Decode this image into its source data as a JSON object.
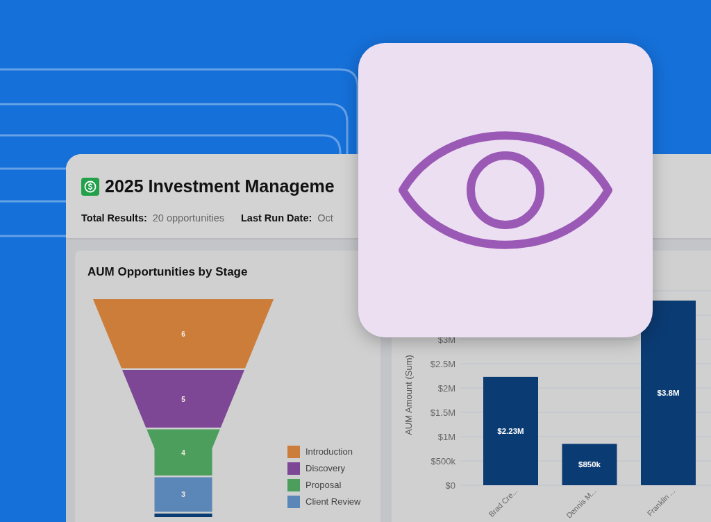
{
  "window": {
    "title": "2025 Investment Manageme",
    "meta": [
      {
        "label": "Total Results:",
        "value": "20 opportunities"
      },
      {
        "label": "Last Run Date:",
        "value": "Oct"
      }
    ]
  },
  "panels": [
    {
      "kind": "funnel",
      "title": "AUM Opportunities by Stage",
      "stages": [
        {
          "label": "Introduction",
          "value": "6",
          "color": "#cc7d3a"
        },
        {
          "label": "Discovery",
          "value": "5",
          "color": "#7d4795"
        },
        {
          "label": "Proposal",
          "value": "4",
          "color": "#4c9e5c"
        },
        {
          "label": "Client Review",
          "value": "3",
          "color": "#5b87b8"
        },
        {
          "color": "#0b3b73"
        }
      ]
    },
    {
      "kind": "bar",
      "chart_data": {
        "type": "bar",
        "ylabel": "AUM Amount (Sum)",
        "categories": [
          "Brad Cre...",
          "Dennis M...",
          "Franklin ..."
        ],
        "series": [
          {
            "color": "#0b3b73",
            "values": [
              2230000,
              850000,
              3800000
            ]
          }
        ],
        "grid": true,
        "ylim": [
          0,
          4000000
        ],
        "yticks": [
          {
            "value": 0,
            "label": "$0"
          },
          {
            "value": 500000,
            "label": "$500k"
          },
          {
            "value": 1000000,
            "label": "$1M"
          },
          {
            "value": 1500000,
            "label": "$1.5M"
          },
          {
            "value": 2000000,
            "label": "$2M"
          },
          {
            "value": 2500000,
            "label": "$2.5M"
          },
          {
            "value": 3000000,
            "label": "$3M"
          }
        ],
        "value_labels": [
          "$2.23M",
          "$850k",
          "$3.8M"
        ]
      }
    }
  ]
}
